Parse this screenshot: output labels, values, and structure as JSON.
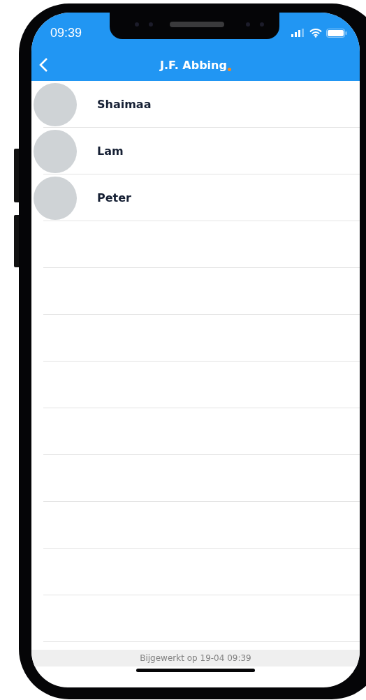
{
  "status_bar": {
    "time": "09:39"
  },
  "nav_bar": {
    "title": "J.F. Abbing"
  },
  "contacts": [
    {
      "name": "Shaimaa"
    },
    {
      "name": "Lam"
    },
    {
      "name": "Peter"
    }
  ],
  "footer": {
    "text": "Bijgewerkt op 19-04 09:39"
  }
}
